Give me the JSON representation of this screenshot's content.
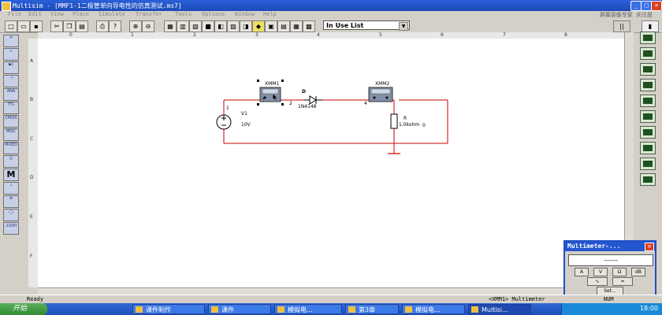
{
  "window": {
    "title": "Multisim - [MMF1-1二极管单向导电性的仿真测试.ms7]",
    "watermark": "屏幕录像专家 未注册"
  },
  "menu": [
    "File",
    "Edit",
    "View",
    "Place",
    "Simulate",
    "Transfer",
    "Tools",
    "Options",
    "Window",
    "Help"
  ],
  "toolbar": {
    "in_use_list": "In Use List"
  },
  "ruler": {
    "columns": [
      "0",
      "1",
      "2",
      "3",
      "4",
      "5",
      "6",
      "7",
      "8"
    ],
    "rows": [
      "A",
      "B",
      "C",
      "D",
      "E",
      "F"
    ]
  },
  "left_palette": [
    "",
    "",
    "",
    "",
    "ANA",
    "TTL",
    "CMOS",
    "MISC",
    "MIXED",
    "",
    "M",
    "",
    "",
    "",
    ".com"
  ],
  "circuit": {
    "xmm1": "XMM1",
    "xmm2": "XMM2",
    "diode_ref": "D",
    "diode_model": "1N4148",
    "node_2": "2",
    "node_4": "4",
    "node_0": "0",
    "node_1": "1",
    "v1_ref": "V1",
    "v1_value": "10V",
    "r_ref": "R",
    "r_value": "1.0kohm",
    "mm_plus": "+",
    "mm_minus": "-"
  },
  "statusbar": {
    "left": "Ready",
    "center": "<XMM1> Multimeter",
    "right": "NUM"
  },
  "taskbar": {
    "start": "开始",
    "tasks": [
      "课件制作",
      "课件",
      "模拟电...",
      "第3章",
      "模拟电...",
      "Multisi..."
    ],
    "clock": "18:00"
  },
  "multimeter": {
    "title": "Multimeter-...",
    "display": "------",
    "buttons": [
      "A",
      "V",
      "Ω",
      "dB"
    ],
    "set": "Set..."
  }
}
